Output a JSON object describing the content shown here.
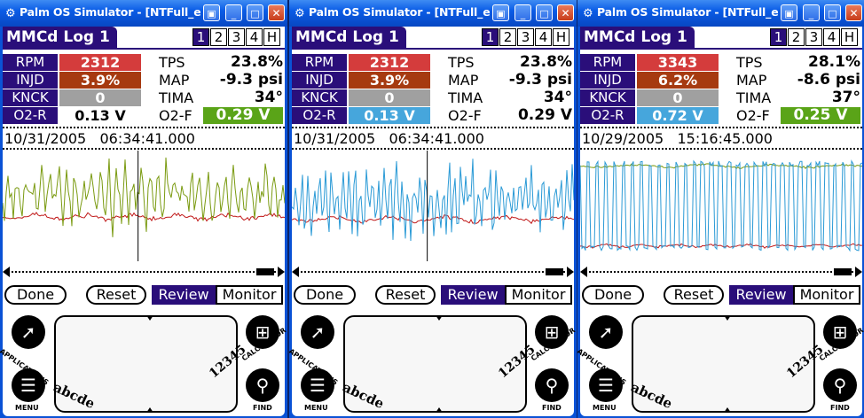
{
  "colors": {
    "title_bg": "#2a0e7a",
    "red": "#d43c3c",
    "brown": "#a63a10",
    "gray": "#a0a0a0",
    "blue": "#46a6dc",
    "green": "#5aa418",
    "trace_olive": "#7a9a10",
    "trace_red": "#c01818",
    "trace_blue": "#2a9ad6"
  },
  "windows": [
    {
      "title": "Palm OS Simulator - [NTFull_enU",
      "app_title": "MMCd Log 1",
      "pages": [
        "1",
        "2",
        "3",
        "4",
        "H"
      ],
      "active_page": 0,
      "rows": [
        {
          "label": "RPM",
          "value": "2312",
          "value_bg": "#d43c3c",
          "label2": "TPS",
          "value2": "23.8%",
          "value2_bg": ""
        },
        {
          "label": "INJD",
          "value": "3.9%",
          "value_bg": "#a63a10",
          "label2": "MAP",
          "value2": "-9.3 psi",
          "value2_bg": ""
        },
        {
          "label": "KNCK",
          "value": "0",
          "value_bg": "#a0a0a0",
          "label2": "TIMA",
          "value2": "34°",
          "value2_bg": ""
        },
        {
          "label": "O2-R",
          "value": "0.13 V",
          "value_bg": "",
          "label2": "O2-F",
          "value2": "0.29 V",
          "value2_bg": "#5aa418"
        }
      ],
      "timestamp": "10/31/2005   06:34:41.000",
      "traces": [
        {
          "color": "#c01818",
          "base": 0.6,
          "amp": 0.04,
          "freq": 0.3,
          "noise": 0.02
        },
        {
          "color": "#7a9a10",
          "base": 0.4,
          "amp": 0.3,
          "freq": 1.7,
          "noise": 0.2
        }
      ],
      "cursor": 0.48,
      "buttons": {
        "done": "Done",
        "reset": "Reset",
        "review": "Review",
        "monitor": "Monitor"
      },
      "silk": {
        "applications": "APPLICATIONS",
        "menu": "MENU",
        "calculator": "CALCULATOR",
        "find": "FIND",
        "abc": "abcde",
        "num": "12345"
      }
    },
    {
      "title": "Palm OS Simulator - [NTFull_enU",
      "app_title": "MMCd Log 1",
      "pages": [
        "1",
        "2",
        "3",
        "4",
        "H"
      ],
      "active_page": 0,
      "rows": [
        {
          "label": "RPM",
          "value": "2312",
          "value_bg": "#d43c3c",
          "label2": "TPS",
          "value2": "23.8%",
          "value2_bg": ""
        },
        {
          "label": "INJD",
          "value": "3.9%",
          "value_bg": "#a63a10",
          "label2": "MAP",
          "value2": "-9.3 psi",
          "value2_bg": ""
        },
        {
          "label": "KNCK",
          "value": "0",
          "value_bg": "#a0a0a0",
          "label2": "TIMA",
          "value2": "34°",
          "value2_bg": ""
        },
        {
          "label": "O2-R",
          "value": "0.13 V",
          "value_bg": "#46a6dc",
          "label2": "O2-F",
          "value2": "0.29 V",
          "value2_bg": ""
        }
      ],
      "timestamp": "10/31/2005   06:34:41.000",
      "traces": [
        {
          "color": "#c01818",
          "base": 0.62,
          "amp": 0.04,
          "freq": 0.25,
          "noise": 0.02
        },
        {
          "color": "#2a9ad6",
          "base": 0.45,
          "amp": 0.38,
          "freq": 2.4,
          "noise": 0.15
        }
      ],
      "cursor": 0.48,
      "buttons": {
        "done": "Done",
        "reset": "Reset",
        "review": "Review",
        "monitor": "Monitor"
      },
      "silk": {
        "applications": "APPLICATIONS",
        "menu": "MENU",
        "calculator": "CALCULATOR",
        "find": "FIND",
        "abc": "abcde",
        "num": "12345"
      }
    },
    {
      "title": "Palm OS Simulator - [NTFull_enU",
      "app_title": "MMCd Log 1",
      "pages": [
        "1",
        "2",
        "3",
        "4",
        "H"
      ],
      "active_page": 0,
      "rows": [
        {
          "label": "RPM",
          "value": "3343",
          "value_bg": "#d43c3c",
          "label2": "TPS",
          "value2": "28.1%",
          "value2_bg": ""
        },
        {
          "label": "INJD",
          "value": "6.2%",
          "value_bg": "#a63a10",
          "label2": "MAP",
          "value2": "-8.6 psi",
          "value2_bg": ""
        },
        {
          "label": "KNCK",
          "value": "0",
          "value_bg": "#a0a0a0",
          "label2": "TIMA",
          "value2": "37°",
          "value2_bg": ""
        },
        {
          "label": "O2-R",
          "value": "0.72 V",
          "value_bg": "#46a6dc",
          "label2": "O2-F",
          "value2": "0.25 V",
          "value2_bg": "#5aa418"
        }
      ],
      "timestamp": "10/29/2005   15:16:45.000",
      "traces": [
        {
          "color": "#7a9a10",
          "base": 0.14,
          "amp": 0.02,
          "freq": 0.2,
          "noise": 0.01
        },
        {
          "color": "#c01818",
          "base": 0.86,
          "amp": 0.02,
          "freq": 0.4,
          "noise": 0.01
        },
        {
          "color": "#2a9ad6",
          "base": 0.5,
          "amp": 0.38,
          "freq": 1.6,
          "noise": 0.05,
          "square": true
        }
      ],
      "cursor": -1,
      "buttons": {
        "done": "Done",
        "reset": "Reset",
        "review": "Review",
        "monitor": "Monitor"
      },
      "silk": {
        "applications": "APPLICATIONS",
        "menu": "MENU",
        "calculator": "CALCULATOR",
        "find": "FIND",
        "abc": "abcde",
        "num": "12345"
      }
    }
  ]
}
